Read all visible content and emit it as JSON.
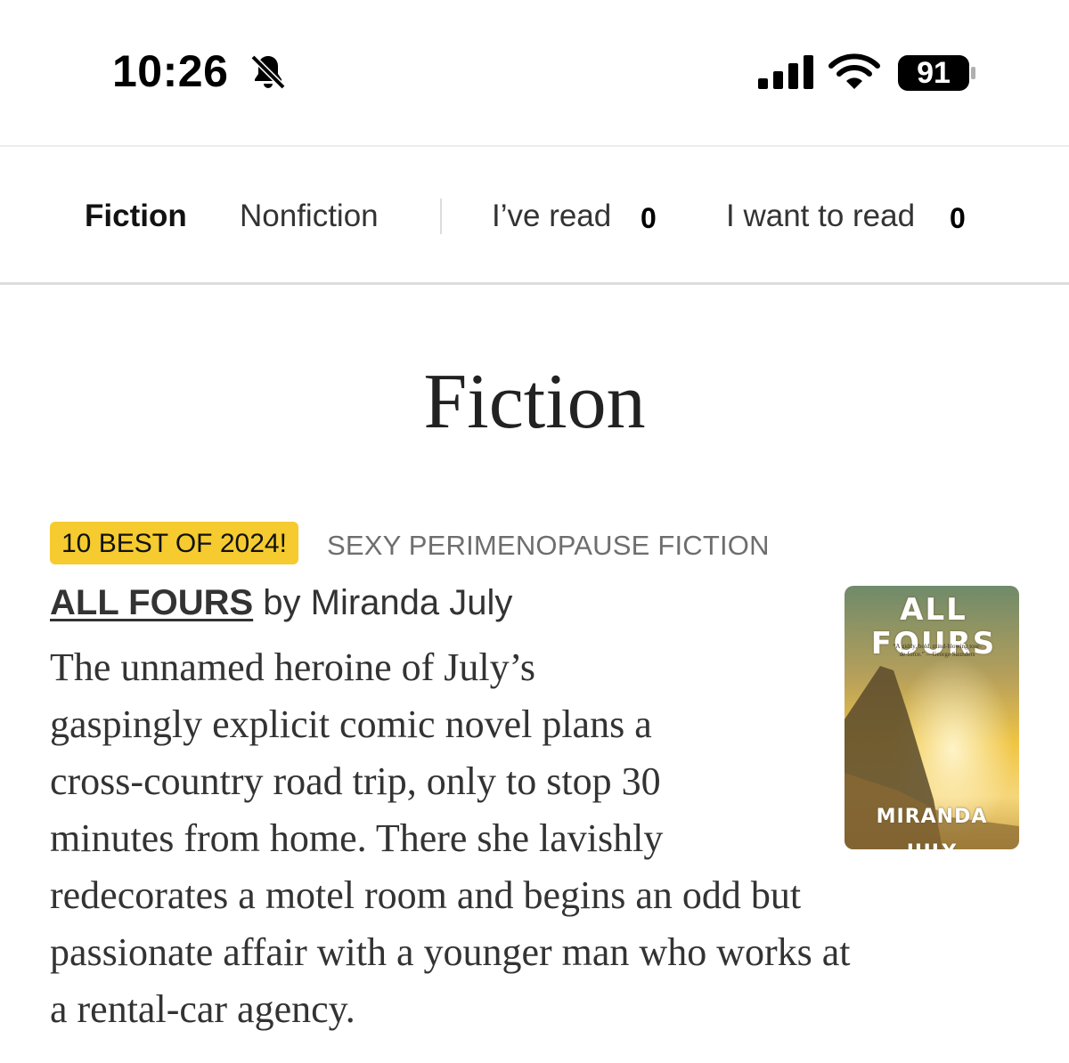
{
  "status": {
    "time": "10:26",
    "battery_level": "91",
    "icons": [
      "bell-slash-icon",
      "cellular-signal-icon",
      "wifi-icon",
      "battery-icon"
    ]
  },
  "tabs": {
    "fiction": "Fiction",
    "nonfiction": "Nonfiction",
    "read_label": "I’ve read",
    "read_count": "0",
    "want_label": "I want to read",
    "want_count": "0"
  },
  "main": {
    "title": "Fiction",
    "book": {
      "badge": "10 BEST OF 2024!",
      "category": "SEXY PERIMENOPAUSE FICTION",
      "title": "ALL FOURS",
      "byline": " by Miranda July",
      "description_lines": [
        "The unnamed heroine of July’s",
        "gaspingly explicit comic novel plans a",
        "cross-country road trip, only to stop 30",
        "minutes from home. There she lavishly",
        "redecorates a motel room and begins an odd but",
        "passionate affair with a younger man who works at",
        "a rental-car agency."
      ],
      "cover": {
        "title_text": "ALL FOURS",
        "author_text": "MIRANDA JULY",
        "blurb": "“A giddy, bold, mind-blowing tour-de-force.” —George Saunders"
      }
    }
  },
  "colors": {
    "badge": "#f5cb2f",
    "text": "#333333",
    "muted": "#6e6e6e",
    "divider": "#dddddd"
  }
}
